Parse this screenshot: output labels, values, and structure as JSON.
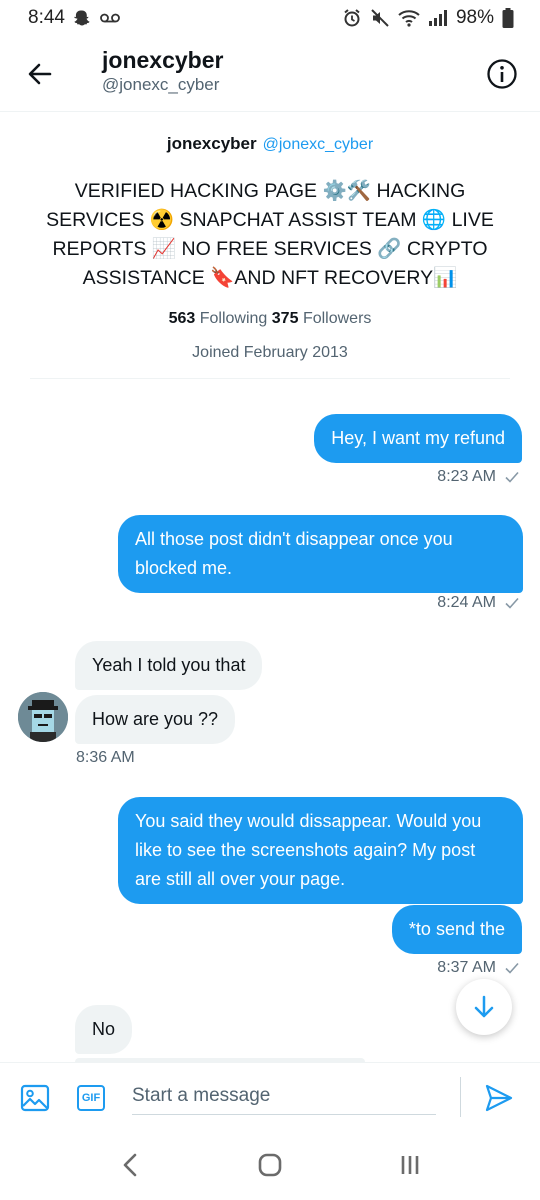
{
  "status_bar": {
    "time": "8:44",
    "battery": "98%"
  },
  "header": {
    "name": "jonexcyber",
    "handle": "@jonexc_cyber"
  },
  "profile": {
    "name": "jonexcyber",
    "handle": "@jonexc_cyber",
    "bio_lines": [
      "VERIFIED HACKING PAGE ⚙️🛠️ HACKING",
      "SERVICES ☢️ SNAPCHAT ASSIST TEAM 🌐 LIVE",
      "REPORTS 📈 NO FREE SERVICES 🔗 CRYPTO",
      "ASSISTANCE 🔖AND NFT RECOVERY📊"
    ],
    "following_count": "563",
    "following_label": "Following",
    "followers_count": "375",
    "followers_label": "Followers",
    "joined": "Joined February 2013"
  },
  "messages": [
    {
      "direction": "out",
      "text": "Hey, I want my refund"
    },
    {
      "direction": "out",
      "time": "8:23 AM"
    },
    {
      "direction": "out",
      "text": "All those post didn't disappear once you blocked me."
    },
    {
      "direction": "out",
      "time": "8:24 AM"
    },
    {
      "direction": "in",
      "text": "Yeah I told you that"
    },
    {
      "direction": "in",
      "text": "How are you ??"
    },
    {
      "direction": "in",
      "time": "8:36 AM"
    },
    {
      "direction": "out",
      "text": "You said they would dissappear. Would you like to see the screenshots again? My post are still all over your page."
    },
    {
      "direction": "out",
      "text": "*to send the"
    },
    {
      "direction": "out",
      "time": "8:37 AM"
    },
    {
      "direction": "in",
      "text": "No"
    }
  ],
  "composer": {
    "placeholder": "Start a message",
    "gif_label": "GIF"
  },
  "icons": [
    "back-arrow-icon",
    "info-icon",
    "image-icon",
    "gif-icon",
    "send-icon",
    "arrow-down-icon",
    "nav-back-icon",
    "nav-home-icon",
    "nav-recents-icon"
  ],
  "colors": {
    "accent": "#1d9bf0",
    "incoming_bubble": "#eff3f4",
    "text": "#0f1419",
    "muted": "#536471"
  }
}
